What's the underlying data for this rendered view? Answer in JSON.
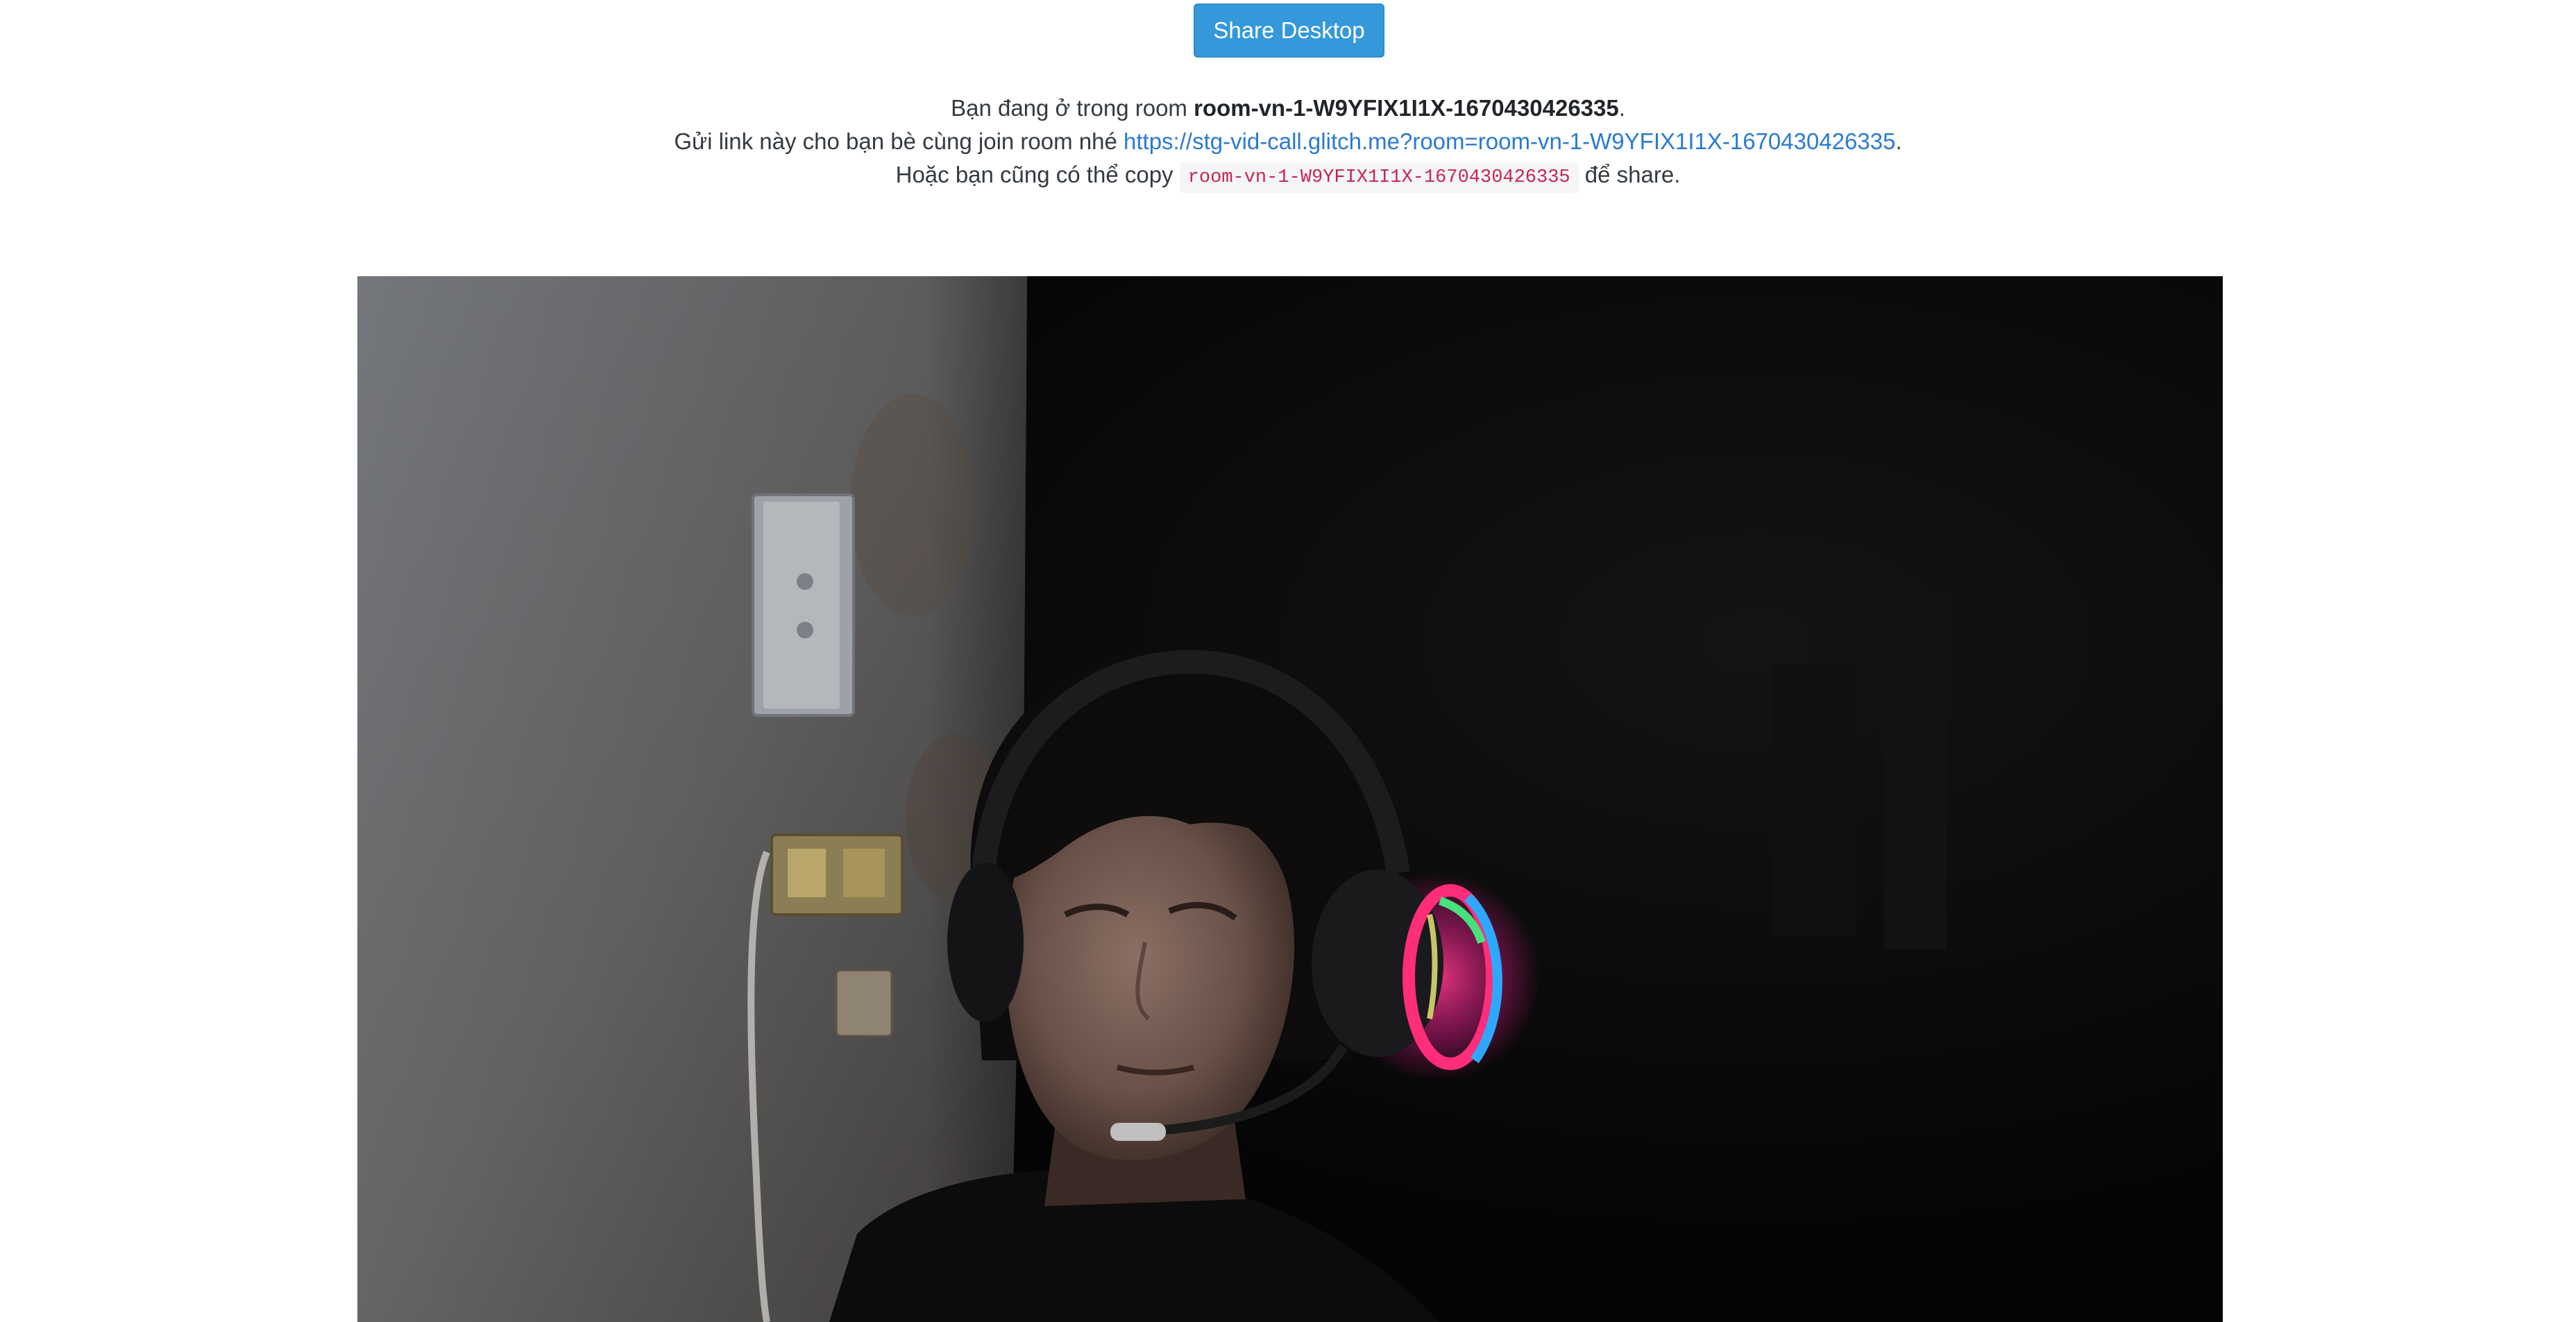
{
  "toolbar": {
    "share_desktop_label": "Share Desktop"
  },
  "room_info": {
    "line1_prefix": "Bạn đang ở trong room ",
    "room_name": "room-vn-1-W9YFIX1I1X-1670430426335",
    "line1_suffix": ".",
    "line2_prefix": "Gửi link này cho bạn bè cùng join room nhé ",
    "room_link": "https://stg-vid-call.glitch.me?room=room-vn-1-W9YFIX1I1X-1670430426335",
    "line2_suffix": ".",
    "line3_prefix": "Hoặc bạn cũng có thể copy ",
    "room_code": "room-vn-1-W9YFIX1I1X-1670430426335",
    "line3_suffix": " để share."
  },
  "colors": {
    "button_bg": "#3498db",
    "link": "#2a7ad3",
    "code_text": "#c7254e"
  }
}
